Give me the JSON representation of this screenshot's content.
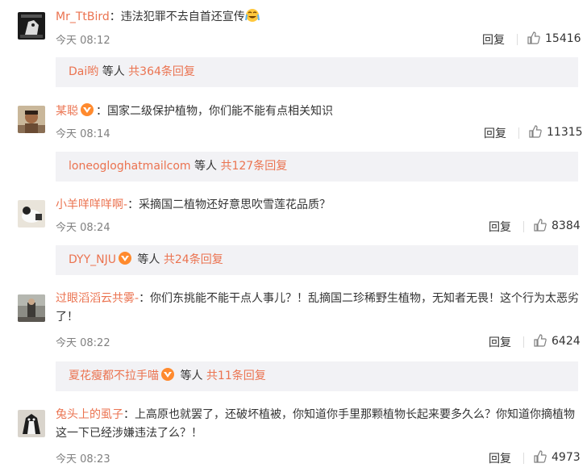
{
  "comments": [
    {
      "user": "Mr_TtBird",
      "text": "：违法犯罪不去自首还宣传",
      "time": "今天 08:12",
      "reply_label": "回复",
      "likes": "15416",
      "replies": {
        "user": "Dai哟",
        "middle": " 等人 ",
        "count": "共364条回复"
      }
    },
    {
      "user": "某聪",
      "text": "：国家二级保护植物，你们能不能有点相关知识",
      "time": "今天 08:14",
      "reply_label": "回复",
      "likes": "11315",
      "replies": {
        "user": "loneogloghatmailcom",
        "middle": " 等人 ",
        "count": "共127条回复"
      }
    },
    {
      "user": "小羊咩咩咩啊-",
      "text": "：采摘国二植物还好意思吹雪莲花品质？",
      "time": "今天 08:24",
      "reply_label": "回复",
      "likes": "8384",
      "replies": {
        "user": "DYY_NJU",
        "middle": " 等人 ",
        "count": "共24条回复"
      }
    },
    {
      "user": "过眼滔滔云共雾-",
      "text": "：你们东挑能不能干点人事儿？！乱摘国二珍稀野生植物，无知者无畏！这个行为太恶劣了！",
      "time": "今天 08:22",
      "reply_label": "回复",
      "likes": "6424",
      "replies": {
        "user": "夏花瘦都不拉手喵",
        "middle": " 等人 ",
        "count": "共11条回复"
      }
    },
    {
      "user": "兔头上的虱子",
      "text": "：上高原也就罢了，还破坏植被，你知道你手里那颗植物长起来要多久么？你知道你摘植物这一下已经涉嫌违法了么？！",
      "time": "今天 08:23",
      "reply_label": "回复",
      "likes": "4973"
    }
  ],
  "colors": {
    "link": "#eb7350",
    "meta": "#808080",
    "reply_bg": "#f2f2f5"
  },
  "icons": {
    "like": "thumbs-up-icon",
    "vip": "vip-badge-icon",
    "emoji": "crying-laugh-emoji"
  }
}
